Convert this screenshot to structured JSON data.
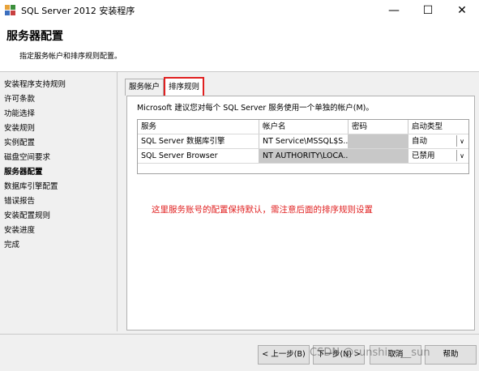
{
  "window": {
    "title": "SQL Server 2012 安装程序",
    "minimize_glyph": "—",
    "maximize_glyph": "☐",
    "close_glyph": "✕"
  },
  "header": {
    "title": "服务器配置",
    "subtitle": "指定服务帐户和排序规则配置。"
  },
  "nav": {
    "items": [
      {
        "label": "安装程序支持规则"
      },
      {
        "label": "许可条款"
      },
      {
        "label": "功能选择"
      },
      {
        "label": "安装规则"
      },
      {
        "label": "实例配置"
      },
      {
        "label": "磁盘空间要求"
      },
      {
        "label": "服务器配置"
      },
      {
        "label": "数据库引擎配置"
      },
      {
        "label": "错误报告"
      },
      {
        "label": "安装配置规则"
      },
      {
        "label": "安装进度"
      },
      {
        "label": "完成"
      }
    ],
    "active_index": 6
  },
  "tabs": [
    {
      "label": "服务帐户"
    },
    {
      "label": "排序规则"
    }
  ],
  "panel": {
    "recommend_text": "Microsoft 建议您对每个 SQL Server 服务使用一个单独的帐户(M)。",
    "columns": [
      "服务",
      "帐户名",
      "密码",
      "启动类型"
    ],
    "rows": [
      {
        "service": "SQL Server 数据库引擎",
        "account": "NT Service\\MSSQL$S...",
        "password": "",
        "startup": "自动"
      },
      {
        "service": "SQL Server Browser",
        "account": "NT AUTHORITY\\LOCA...",
        "password": "",
        "startup": "已禁用"
      }
    ],
    "dropdown_glyph": "∨"
  },
  "annotation": "这里服务账号的配置保持默认，需注意后面的排序规则设置",
  "buttons": {
    "back": "< 上一步(B)",
    "next": "下一步(N) >",
    "cancel": "取消",
    "help": "帮助"
  },
  "watermark": "CSDN @sunshine__sun"
}
